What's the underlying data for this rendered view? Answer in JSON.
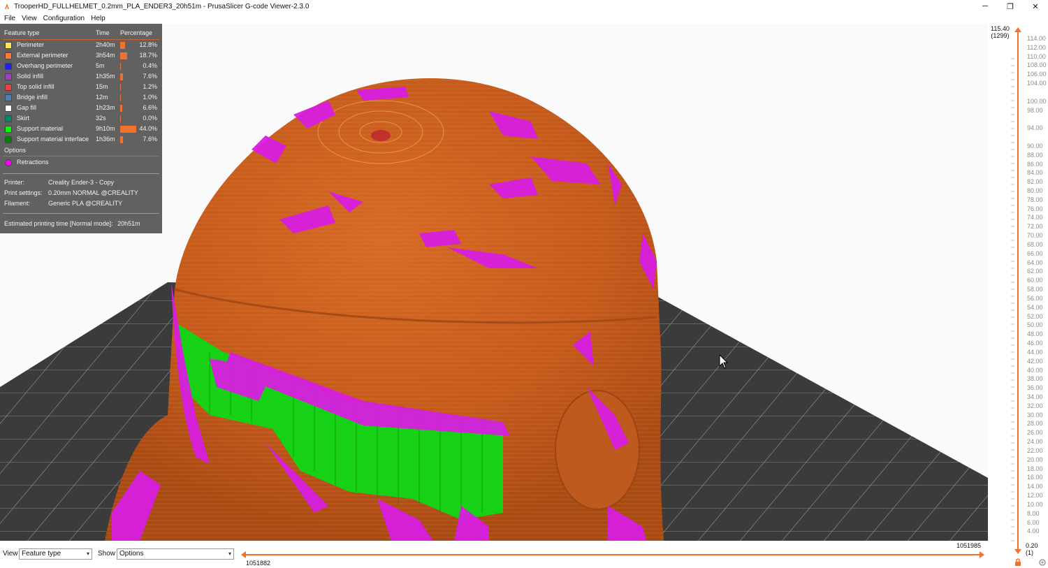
{
  "window": {
    "title": "TrooperHD_FULLHELMET_0.2mm_PLA_ENDER3_20h51m - PrusaSlicer G-code Viewer-2.3.0",
    "minimize": "─",
    "restore": "❐",
    "close": "✕"
  },
  "menu": [
    "File",
    "View",
    "Configuration",
    "Help"
  ],
  "legend": {
    "headers": {
      "feature": "Feature type",
      "time": "Time",
      "percentage": "Percentage"
    },
    "features": [
      {
        "name": "Perimeter",
        "time": "2h40m",
        "pct": "12.8%",
        "value": 12.8,
        "color": "#ffe55c"
      },
      {
        "name": "External perimeter",
        "time": "3h54m",
        "pct": "18.7%",
        "value": 18.7,
        "color": "#ff7c38"
      },
      {
        "name": "Overhang perimeter",
        "time": "5m",
        "pct": "0.4%",
        "value": 0.4,
        "color": "#1f1fff"
      },
      {
        "name": "Solid infill",
        "time": "1h35m",
        "pct": "7.6%",
        "value": 7.6,
        "color": "#9e3fc8"
      },
      {
        "name": "Top solid infill",
        "time": "15m",
        "pct": "1.2%",
        "value": 1.2,
        "color": "#f04040"
      },
      {
        "name": "Bridge infill",
        "time": "12m",
        "pct": "1.0%",
        "value": 1.0,
        "color": "#4d81b8"
      },
      {
        "name": "Gap fill",
        "time": "1h23m",
        "pct": "6.6%",
        "value": 6.6,
        "color": "#ffffff"
      },
      {
        "name": "Skirt",
        "time": "32s",
        "pct": "0.0%",
        "value": 0.0,
        "color": "#00876e"
      },
      {
        "name": "Support material",
        "time": "9h10m",
        "pct": "44.0%",
        "value": 44.0,
        "color": "#00ff00"
      },
      {
        "name": "Support material interface",
        "time": "1h36m",
        "pct": "7.6%",
        "value": 7.6,
        "color": "#008000"
      }
    ],
    "options_label": "Options",
    "options": [
      {
        "name": "Retractions",
        "color": "#ff00ff"
      }
    ],
    "info": [
      {
        "label": "Printer:",
        "value": "Creality Ender-3 - Copy"
      },
      {
        "label": "Print settings:",
        "value": "0.20mm NORMAL @CREALITY"
      },
      {
        "label": "Filament:",
        "value": "Generic PLA @CREALITY"
      }
    ],
    "estimated_label": "Estimated printing time [Normal mode]:",
    "estimated_value": "20h51m"
  },
  "vertical_slider": {
    "top_value": "115.40",
    "top_layer": "(1299)",
    "bottom_value": "0.20",
    "bottom_layer": "(1)",
    "ticks": [
      "114.00",
      "112.00",
      "110.00",
      "108.00",
      "106.00",
      "104.00",
      "100.00",
      "98.00",
      "94.00",
      "90.00",
      "88.00",
      "86.00",
      "84.00",
      "82.00",
      "80.00",
      "78.00",
      "76.00",
      "74.00",
      "72.00",
      "70.00",
      "68.00",
      "66.00",
      "64.00",
      "62.00",
      "60.00",
      "58.00",
      "56.00",
      "54.00",
      "52.00",
      "50.00",
      "48.00",
      "46.00",
      "44.00",
      "42.00",
      "40.00",
      "38.00",
      "36.00",
      "34.00",
      "32.00",
      "30.00",
      "28.00",
      "26.00",
      "24.00",
      "22.00",
      "20.00",
      "18.00",
      "16.00",
      "14.00",
      "12.00",
      "10.00",
      "8.00",
      "6.00",
      "4.00"
    ]
  },
  "bottom": {
    "view_label": "View",
    "view_value": "Feature type",
    "show_label": "Show",
    "show_value": "Options",
    "h_start": "1051882",
    "h_end": "1051985"
  },
  "icons": {
    "app": "prusa-app-icon",
    "lock": "lock-icon",
    "settings": "cog-icon",
    "cursor": "mouse-cursor-icon"
  },
  "colors": {
    "accent": "#f1712f",
    "helmet": "#c85d1e",
    "bed": "#3a3a3a"
  }
}
